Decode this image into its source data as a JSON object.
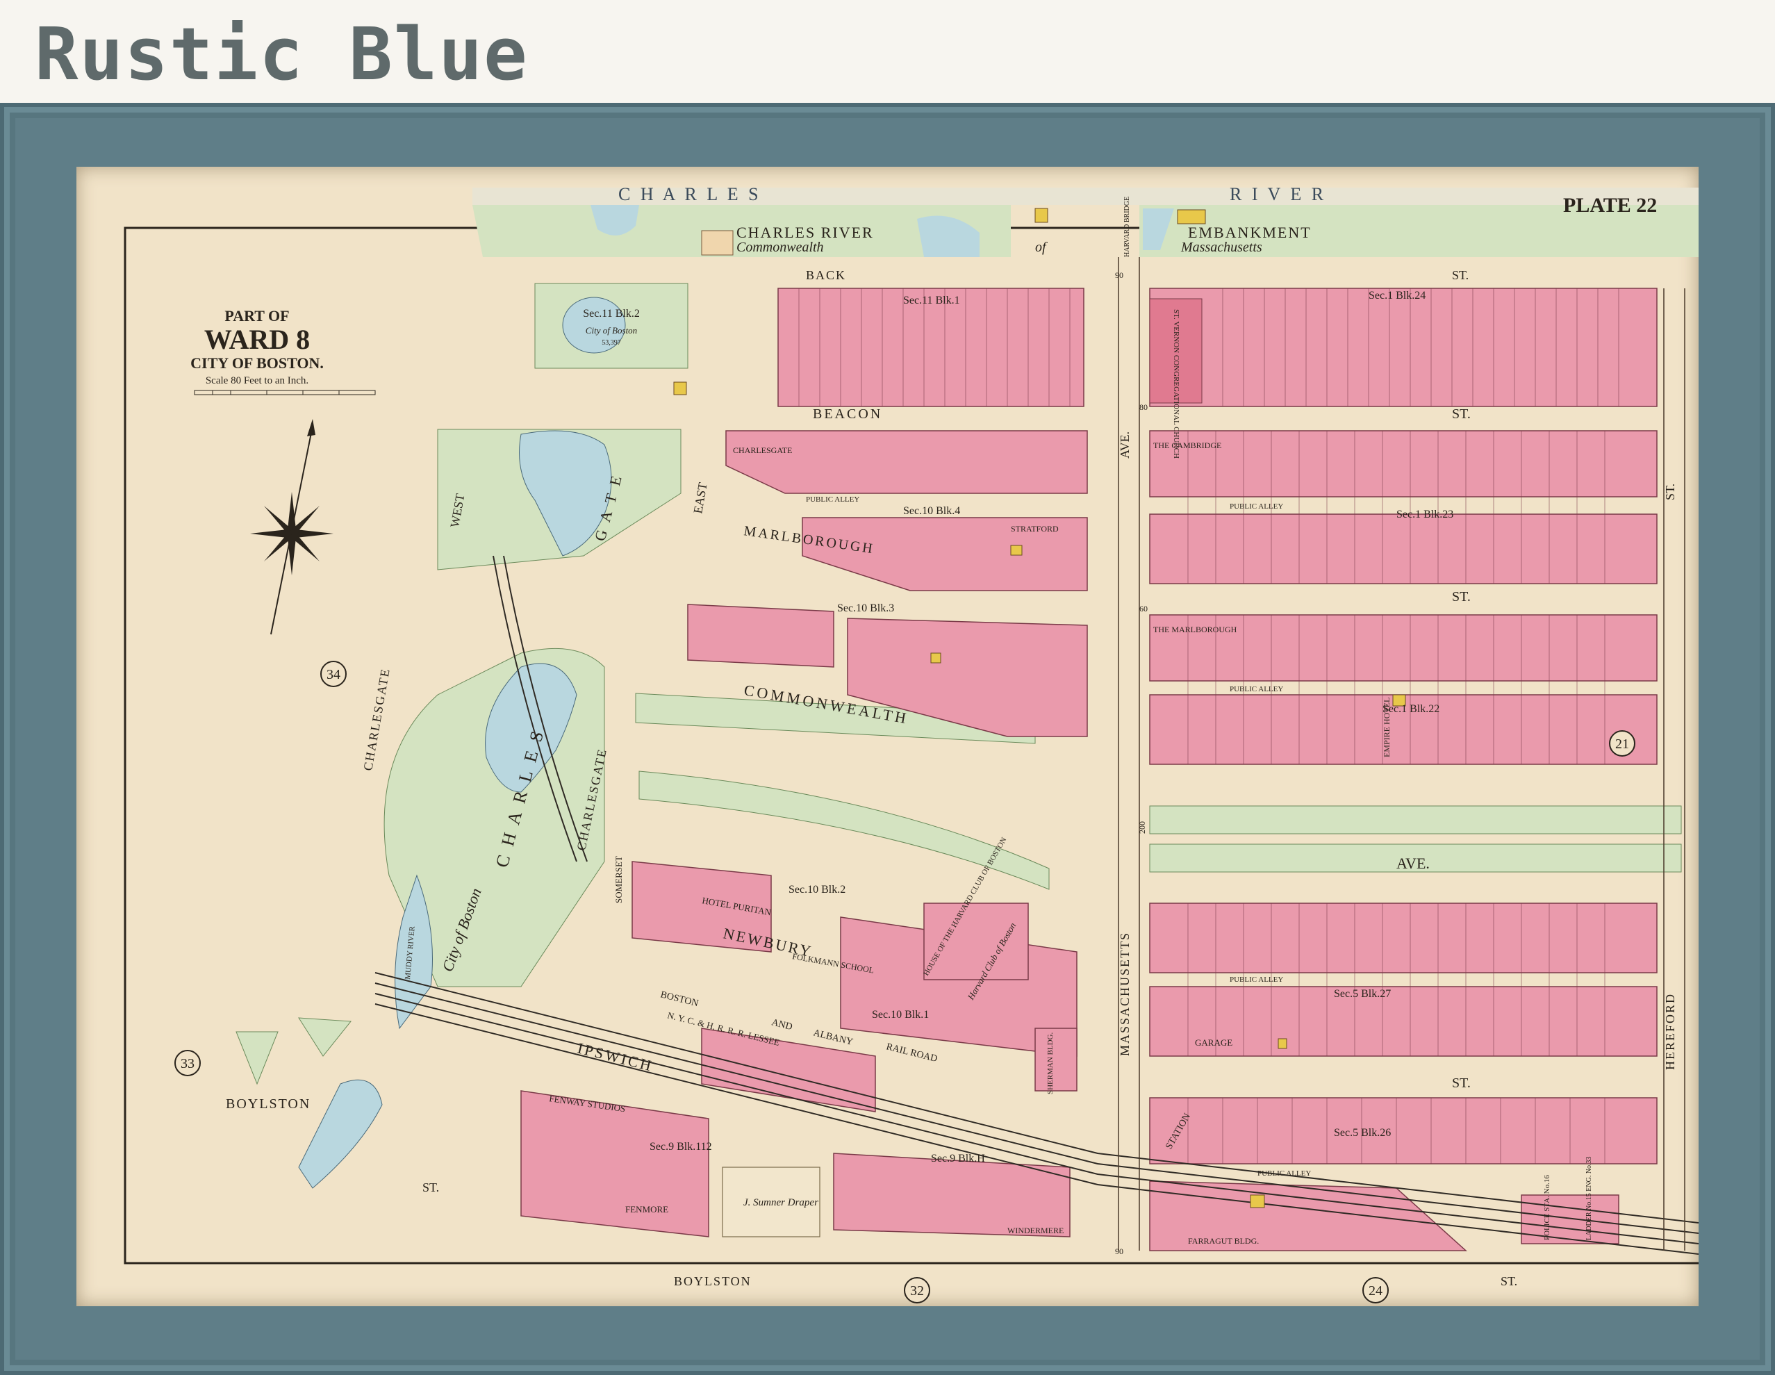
{
  "frame": {
    "title": "Rustic Blue",
    "color": "#5f7e88"
  },
  "map": {
    "plate": "PLATE 22",
    "title_block": {
      "line1": "PART OF",
      "line2": "WARD 8",
      "line3": "CITY OF BOSTON.",
      "scale": "Scale 80 Feet to an Inch."
    },
    "water_labels": [
      "C H A R L E S",
      "R I V E R"
    ],
    "embankment": [
      "CHARLES RIVER",
      "EMBANKMENT"
    ],
    "commonwealth_label": [
      "Commonwealth",
      "of",
      "Massachusetts"
    ],
    "harvard_bridge": "HARVARD BRIDGE",
    "streets": {
      "back": "BACK",
      "back_st": "ST.",
      "beacon": "BEACON",
      "beacon_st": "ST.",
      "marlborough": "MARLBOROUGH",
      "marlborough_st": "ST.",
      "commonwealth": "COMMONWEALTH",
      "ave": "AVE.",
      "newbury": "NEWBURY",
      "newbury_st": "ST.",
      "boylston_left": "BOYLSTON",
      "boylston_bottom": "BOYLSTON",
      "boylston_st": "ST.",
      "ipswich": "IPSWICH",
      "massachusetts": "MASSACHUSETTS",
      "massachusetts_ave": "AVE.",
      "hereford": "HEREFORD",
      "hereford_st": "ST.",
      "charlesgate": "CHARLESGATE",
      "charlesgate_west": "WEST",
      "charlesgate_east": "EAST",
      "charles_gate_park": [
        "C H A R L E S",
        "G A T E"
      ],
      "public_alley": "PUBLIC ALLEY",
      "railroad": [
        "BOSTON",
        "AND",
        "ALBANY",
        "RAIL ROAD"
      ],
      "nyc_hr": "N. Y. C. & H. R. R. R. LESSEE",
      "city_of_boston": "City of Boston",
      "muddy_river": "MUDDY RIVER",
      "st_label": "ST."
    },
    "sections": [
      "Sec.11 Blk.2",
      "Sec.11 Blk.1",
      "Sec.1 Blk.24",
      "Sec.10 Blk.4",
      "Sec.1 Blk.23",
      "Sec.10 Blk.3",
      "Sec.1 Blk.22",
      "Sec.10 Blk.2",
      "Sec.10 Blk.1",
      "Sec.5 Blk.27",
      "Sec.9 Blk.112",
      "Sec.9 Blk.H",
      "Sec.5 Blk.26"
    ],
    "section_owners": {
      "sec11blk2_owner": "City of Boston",
      "sec11blk2_area": "53,397"
    },
    "buildings": [
      "ST. VERNON CONGREGATIONAL CHURCH",
      "CHARLESGATE",
      "STRATFORD",
      "THE CAMBRIDGE",
      "THE MARLBOROUGH",
      "EMPIRE HOTEL",
      "SOMERSET",
      "HOTEL PURITAN",
      "FOLKMANN SCHOOL",
      "HOUSE OF THE HARVARD CLUB OF BOSTON",
      "Harvard Club of Boston",
      "SHERMAN BLDG.",
      "FENWAY STUDIOS",
      "FENMORE",
      "GARAGE",
      "FARRAGUT BLDG.",
      "WINDERMERE",
      "POLICE STA. No.16",
      "LADDER No.15 ENG. No.33",
      "STATION",
      "J. Sumner Draper"
    ],
    "plate_refs": [
      "34",
      "33",
      "21",
      "32",
      "24"
    ],
    "widths": [
      "90",
      "80",
      "60",
      "200"
    ]
  }
}
